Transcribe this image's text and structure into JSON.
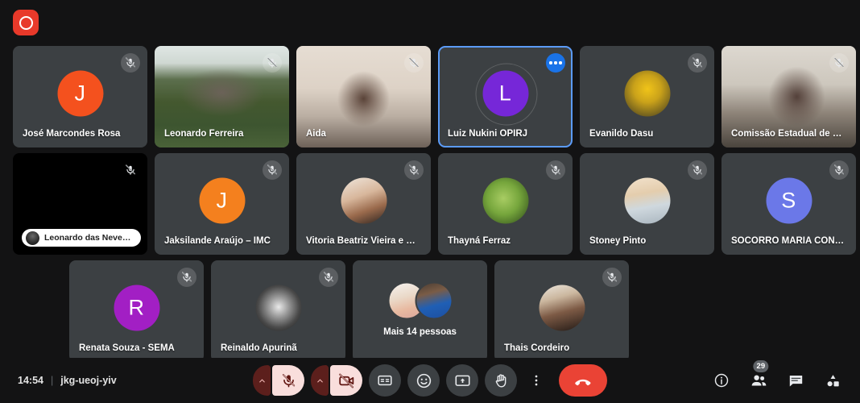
{
  "app": {
    "name": "video-meeting",
    "recording_indicator": "recording-icon"
  },
  "grid": {
    "rows": [
      {
        "tiles": [
          {
            "name": "José Marcondes Rosa",
            "kind": "initial",
            "initial": "J",
            "avatar_color": "#f4511e",
            "muted": true,
            "speaking": false
          },
          {
            "name": "Leonardo Ferreira",
            "kind": "video",
            "video": "vid-leonardo",
            "muted": true,
            "speaking": false
          },
          {
            "name": "Aida",
            "kind": "video",
            "video": "vid-aida",
            "muted": true,
            "speaking": false
          },
          {
            "name": "Luiz Nukini OPIRJ",
            "kind": "initial",
            "initial": "L",
            "avatar_color": "#7627d8",
            "muted": false,
            "speaking": true,
            "more_options": true
          },
          {
            "name": "Evanildo Dasu",
            "kind": "photo",
            "photo": "ph-evanildo",
            "muted": true,
            "speaking": false
          },
          {
            "name": "Comissão Estadual de Va…",
            "kind": "video",
            "video": "vid-comissao",
            "muted": true,
            "speaking": false
          }
        ]
      },
      {
        "tiles": [
          {
            "name": "Leonardo das Neves Ca…",
            "kind": "pill",
            "muted": true,
            "speaking": false,
            "camera_off": true
          },
          {
            "name": "Jaksilande Araújo – IMC",
            "kind": "initial",
            "initial": "J",
            "avatar_color": "#f4801e",
            "muted": true,
            "speaking": false
          },
          {
            "name": "Vitoria Beatriz Vieira e Sil…",
            "kind": "photo",
            "photo": "ph-vitoria",
            "muted": true,
            "speaking": false
          },
          {
            "name": "Thayná Ferraz",
            "kind": "photo",
            "photo": "ph-thayna",
            "muted": true,
            "speaking": false
          },
          {
            "name": "Stoney Pinto",
            "kind": "photo",
            "photo": "ph-stoney",
            "muted": true,
            "speaking": false
          },
          {
            "name": "SOCORRO MARIA COND…",
            "kind": "initial",
            "initial": "S",
            "avatar_color": "#6b78e8",
            "muted": true,
            "speaking": false
          }
        ]
      },
      {
        "tiles": [
          {
            "name": "Renata Souza - SEMA",
            "kind": "initial",
            "initial": "R",
            "avatar_color": "#a21fc4",
            "muted": true,
            "speaking": false
          },
          {
            "name": "Reinaldo Apurinã",
            "kind": "photo",
            "photo": "ph-reinaldo",
            "muted": true,
            "speaking": false
          },
          {
            "name": "Mais 14 pessoas",
            "kind": "overflow",
            "muted": false,
            "speaking": false
          },
          {
            "name": "Thais Cordeiro",
            "kind": "photo",
            "photo": "ph-thais",
            "muted": true,
            "speaking": false
          }
        ]
      }
    ]
  },
  "bottom_bar": {
    "time": "14:54",
    "separator": "|",
    "meeting_code": "jkg-ueoj-yiv",
    "controls": [
      {
        "id": "microphone",
        "icon": "microphone-off-icon",
        "state": "muted",
        "has_chevron": true
      },
      {
        "id": "camera",
        "icon": "camera-off-icon",
        "state": "off",
        "has_chevron": true
      },
      {
        "id": "captions",
        "icon": "closed-captions-icon"
      },
      {
        "id": "reactions",
        "icon": "emoji-smiley-icon"
      },
      {
        "id": "present",
        "icon": "present-screen-icon"
      },
      {
        "id": "raise-hand",
        "icon": "raise-hand-icon"
      },
      {
        "id": "more",
        "icon": "more-vertical-icon"
      },
      {
        "id": "leave-call",
        "icon": "phone-hangup-icon",
        "color": "#ea4335"
      }
    ],
    "right_tools": [
      {
        "id": "meeting-details",
        "icon": "info-icon"
      },
      {
        "id": "people",
        "icon": "people-icon",
        "badge": "29"
      },
      {
        "id": "chat",
        "icon": "chat-icon"
      },
      {
        "id": "activities",
        "icon": "activities-icon"
      }
    ]
  },
  "colors": {
    "background": "#131314",
    "tile": "#3c4043",
    "accent_blue": "#5b9bf8",
    "danger": "#ea4335",
    "recording": "#e8392a"
  }
}
